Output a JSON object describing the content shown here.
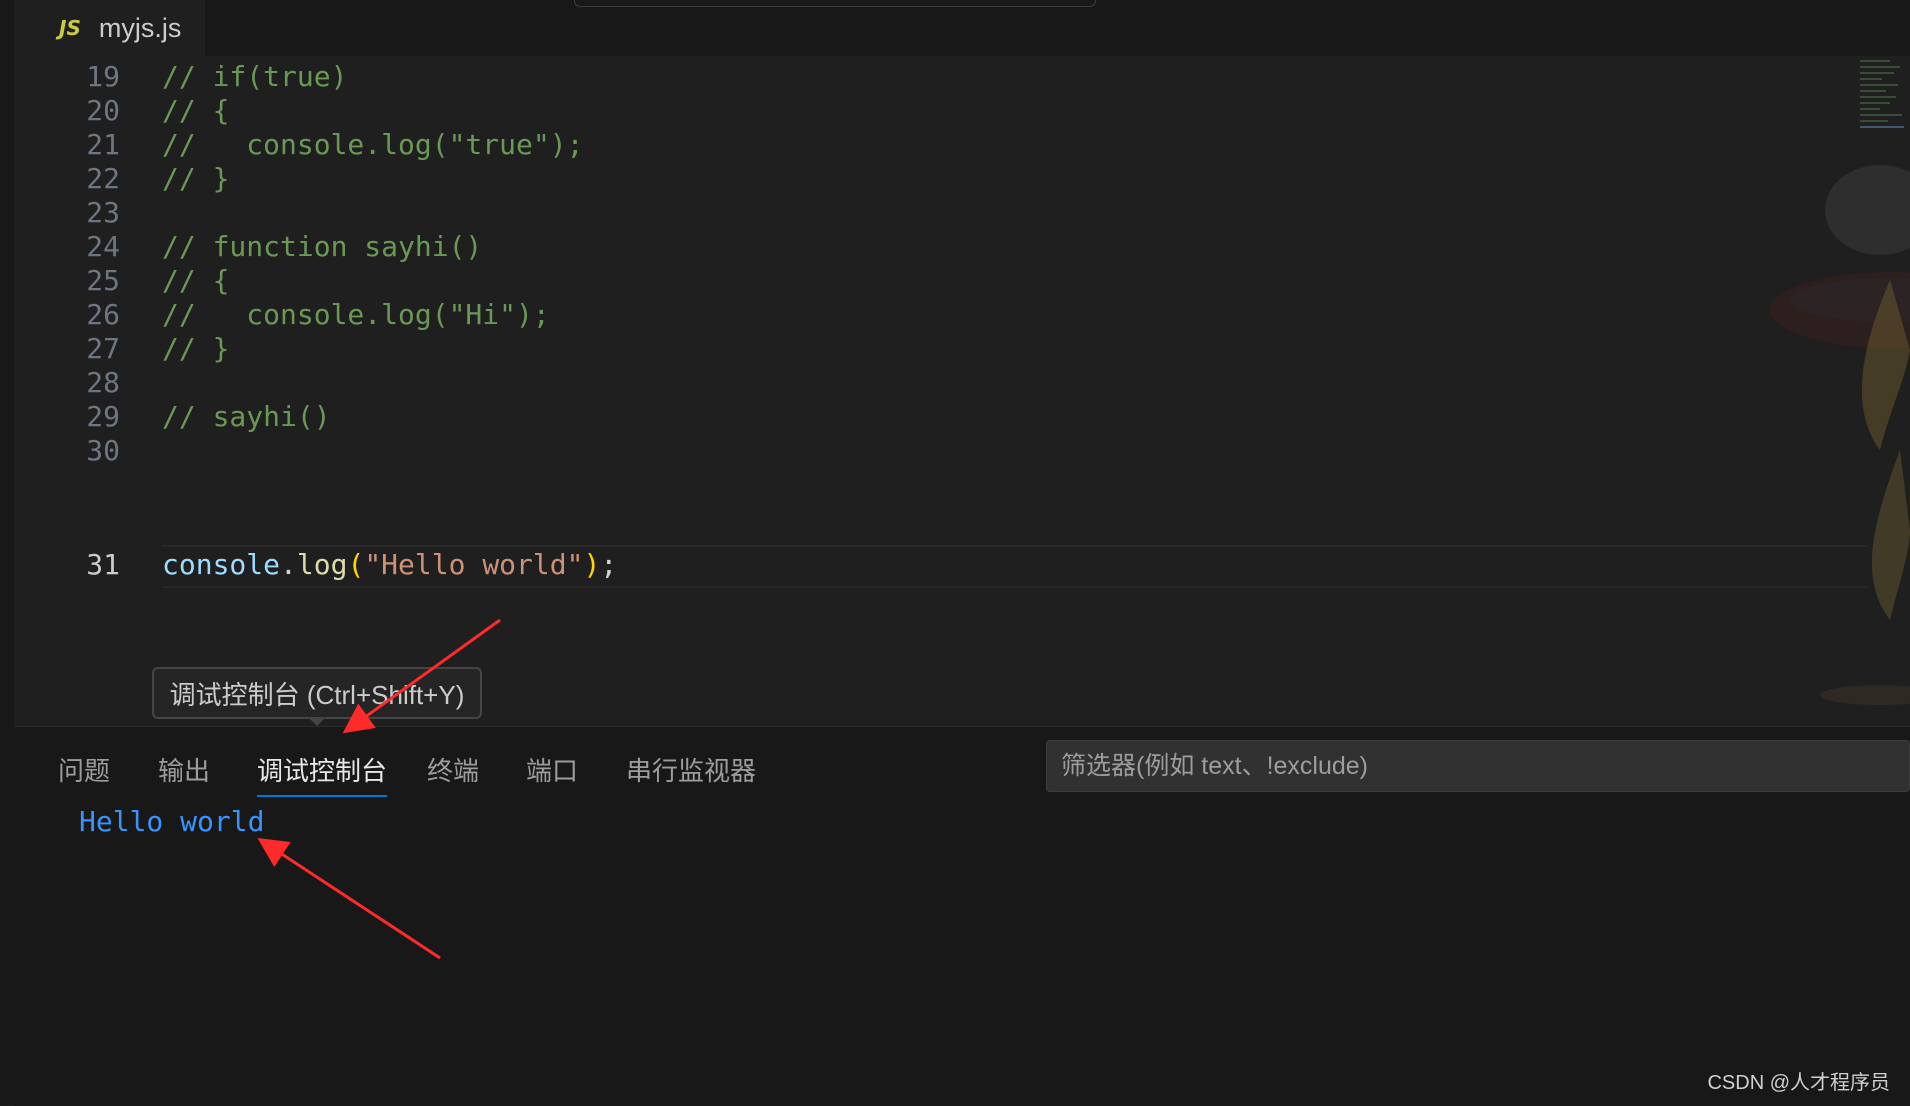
{
  "editor_tab": {
    "icon": "JS",
    "filename": "myjs.js"
  },
  "code_lines": [
    {
      "n": "19",
      "comment": "// if(true)"
    },
    {
      "n": "20",
      "comment": "// {"
    },
    {
      "n": "21",
      "comment": "//   console.log(\"true\");"
    },
    {
      "n": "22",
      "comment": "// }"
    },
    {
      "n": "23",
      "comment": ""
    },
    {
      "n": "24",
      "comment": "// function sayhi()"
    },
    {
      "n": "25",
      "comment": "// {"
    },
    {
      "n": "26",
      "comment": "//   console.log(\"Hi\");"
    },
    {
      "n": "27",
      "comment": "// }"
    },
    {
      "n": "28",
      "comment": ""
    },
    {
      "n": "29",
      "comment": "// sayhi()"
    },
    {
      "n": "30",
      "comment": ""
    }
  ],
  "current_line": {
    "n": "31",
    "obj": "console",
    "dot": ".",
    "method": "log",
    "open": "(",
    "string": "\"Hello world\"",
    "close": ")",
    "semi": ";"
  },
  "tooltip": "调试控制台 (Ctrl+Shift+Y)",
  "panel": {
    "tabs": [
      "问题",
      "输出",
      "调试控制台",
      "终端",
      "端口",
      "串行监视器"
    ],
    "active_tab": "调试控制台",
    "filter_placeholder": "筛选器(例如 text、!exclude)",
    "output": "Hello world"
  },
  "watermark": "CSDN @人才程序员",
  "colors": {
    "accent": "#0078d4",
    "output_text": "#3794ff",
    "annotation_arrow": "#ff2a2a"
  }
}
